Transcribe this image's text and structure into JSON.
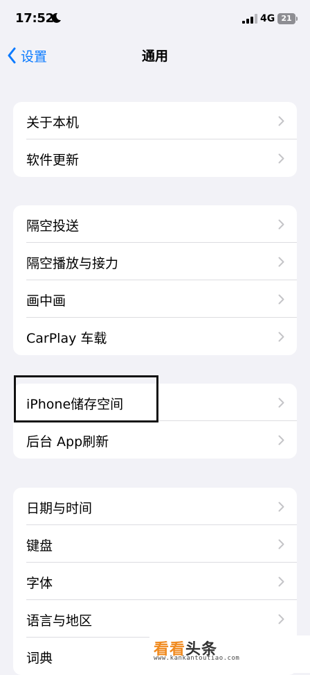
{
  "status_bar": {
    "time": "17:52",
    "network": "4G",
    "battery": "21"
  },
  "nav": {
    "back_label": "设置",
    "title": "通用"
  },
  "groups": [
    {
      "rows": [
        "关于本机",
        "软件更新"
      ]
    },
    {
      "rows": [
        "隔空投送",
        "隔空播放与接力",
        "画中画",
        "CarPlay 车载"
      ]
    },
    {
      "rows": [
        "iPhone储存空间",
        "后台 App刷新"
      ]
    },
    {
      "rows": [
        "日期与时间",
        "键盘",
        "字体",
        "语言与地区",
        "词典"
      ]
    }
  ],
  "watermark": {
    "part1": "看看",
    "part2": "头条",
    "url": "www.kankantoutiao.com"
  }
}
